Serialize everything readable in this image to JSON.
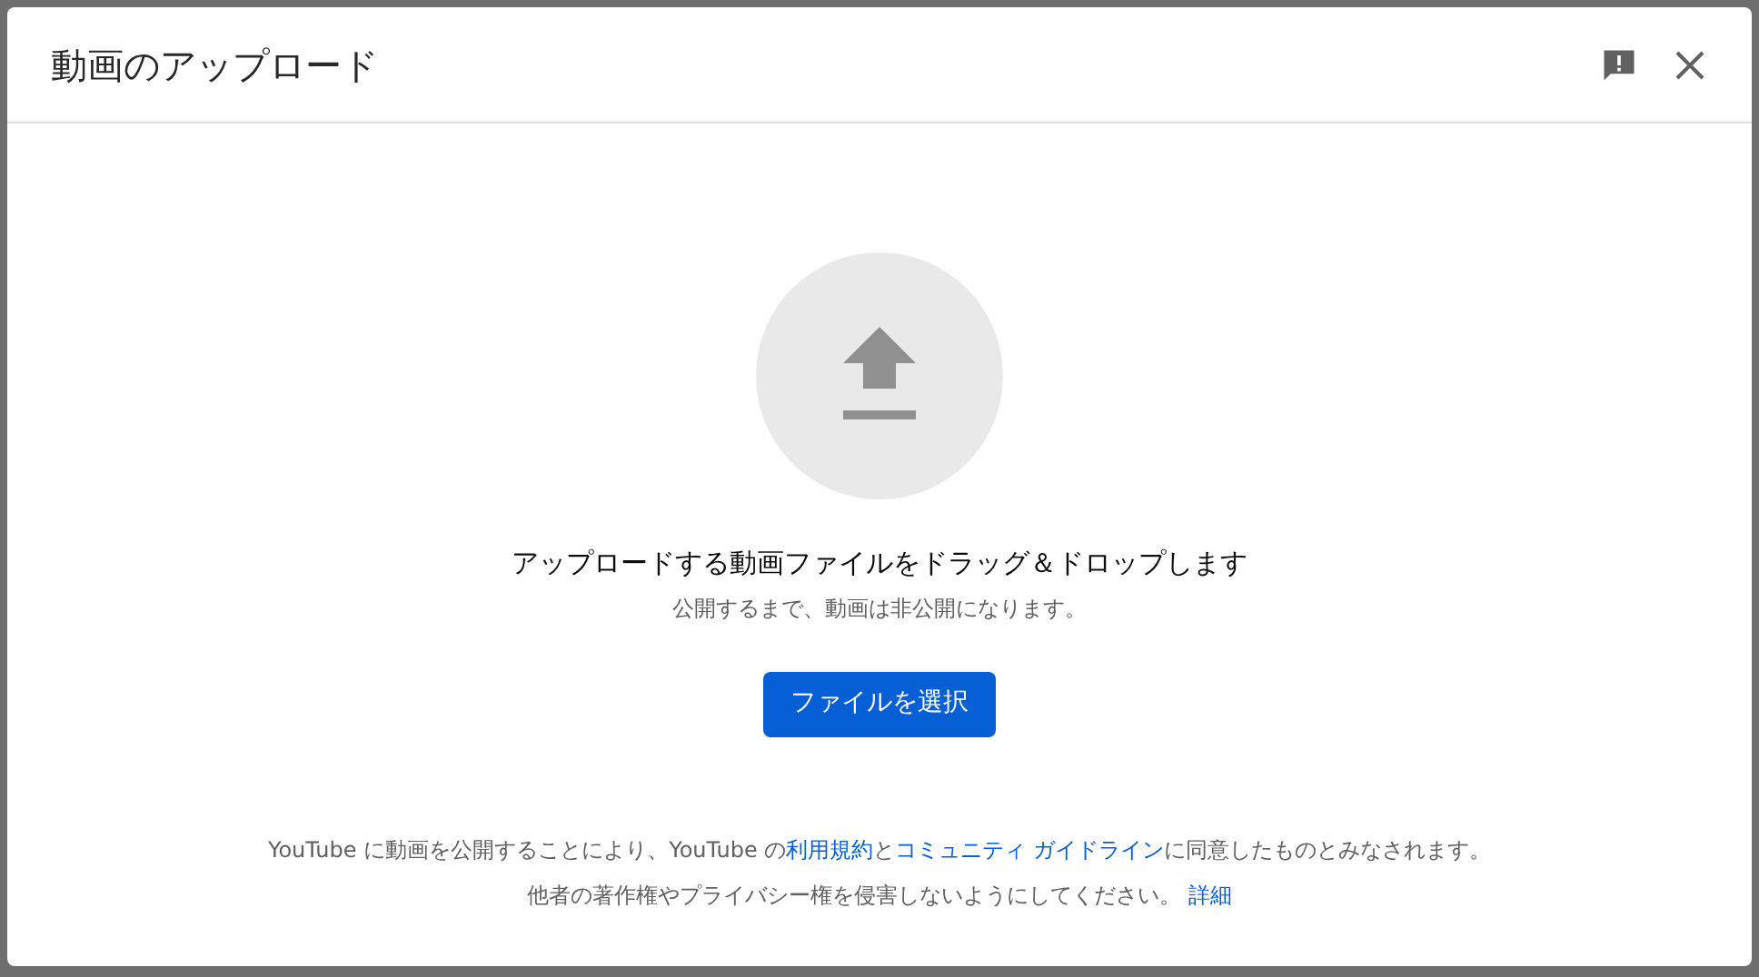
{
  "dialog": {
    "title": "動画のアップロード"
  },
  "drop_zone": {
    "heading": "アップロードする動画ファイルをドラッグ＆ドロップします",
    "subtext": "公開するまで、動画は非公開になります。",
    "button": "ファイルを選択"
  },
  "footer": [
    {
      "parts": [
        {
          "kind": "text",
          "text": "YouTube に動画を公開することにより、YouTube の"
        },
        {
          "kind": "link",
          "text": "利用規約"
        },
        {
          "kind": "text",
          "text": "と"
        },
        {
          "kind": "link",
          "text": "コミュニティ ガイドライン"
        },
        {
          "kind": "text",
          "text": "に同意したものとみなされます。"
        }
      ]
    },
    {
      "parts": [
        {
          "kind": "text",
          "text": "他者の著作権やプライバシー権を侵害しないようにしてください。 "
        },
        {
          "kind": "link",
          "text": "詳細"
        }
      ]
    }
  ]
}
